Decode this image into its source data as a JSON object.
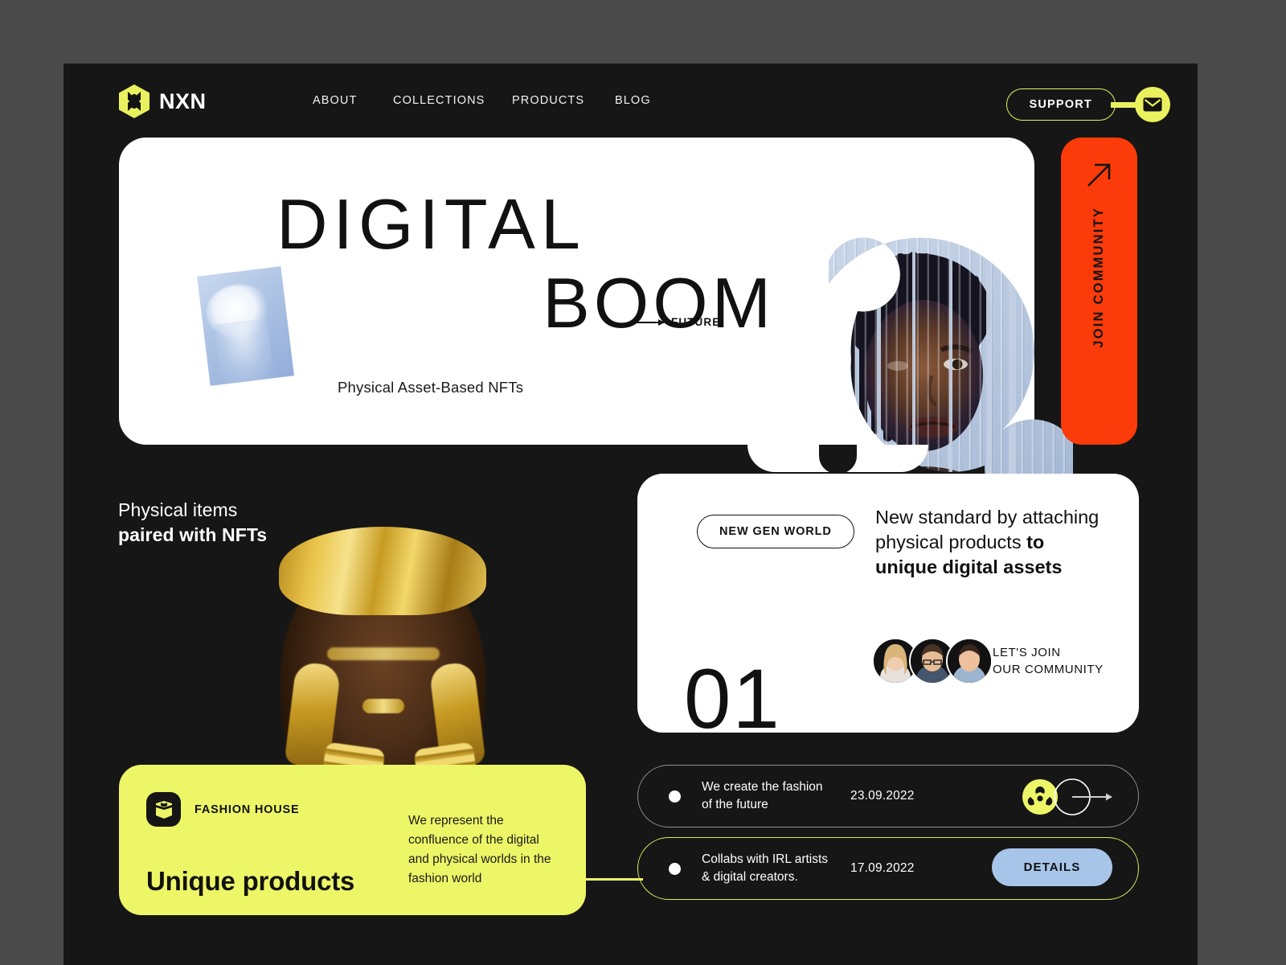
{
  "brand": {
    "logo_icon": "hexagon-x-logo-icon",
    "name": "NXN"
  },
  "nav": {
    "links": [
      {
        "label": "ABOUT"
      },
      {
        "label": "COLLECTIONS"
      },
      {
        "label": "PRODUCTS"
      },
      {
        "label": "BLOG"
      }
    ],
    "support_label": "SUPPORT",
    "mail_icon": "envelope-icon"
  },
  "hero": {
    "title_line1": "DIGITAL",
    "title_line2": "BOOM",
    "future_label": "FUTURE",
    "subtitle": "Physical Asset-Based NFTs",
    "portrait_alt": "sliced-portrait-image"
  },
  "join_community": {
    "label": "JOIN COMMUNITY",
    "arrow_icon": "arrow-up-right-icon",
    "color": "#FB3B09"
  },
  "left_section": {
    "caption_line1": "Physical items",
    "caption_line2": "paired with NFTs",
    "photo_alt": "gold-fashion-model-image"
  },
  "info_card": {
    "tag": "NEW GEN WORLD",
    "headline_plain": "New standard by attaching physical products ",
    "headline_bold": "to unique digital assets",
    "number": "01",
    "community_line1": "LET'S JOIN",
    "community_line2": "OUR COMMUNITY"
  },
  "fashion_card": {
    "icon": "package-icon",
    "label": "FASHION HOUSE",
    "title": "Unique products",
    "paragraph": "We represent the confluence of the digital and physical worlds in the fashion world",
    "color": "#EDF667"
  },
  "news": [
    {
      "text_line1": "We create the fashion",
      "text_line2": "of the future",
      "date": "23.09.2022",
      "action_icon": "venn-arrow-icon"
    },
    {
      "text_line1": "Collabs with IRL artists",
      "text_line2": "& digital creators.",
      "date": "17.09.2022",
      "action_label": "DETAILS"
    }
  ],
  "colors": {
    "accent_yellow": "#EDF667",
    "accent_orange": "#FB3B09",
    "button_blue": "#A7C5E9",
    "frame_bg": "#161616",
    "page_bg": "#4A4A4A"
  }
}
